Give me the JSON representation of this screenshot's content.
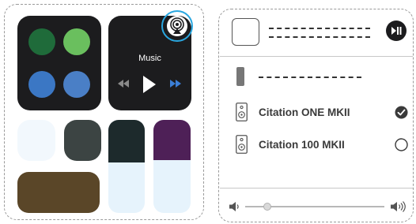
{
  "colors": {
    "tile_dark": "#1c1c1e",
    "dot_green_dark": "#1f6b3a",
    "dot_green_light": "#6abf5e",
    "dot_blue_left": "#3b77c4",
    "dot_blue_right": "#4a7fc6",
    "tile_light": "#f2f8fd",
    "tile_charcoal": "#3c4443",
    "tile_brown": "#5a4628",
    "bar_track": "#e6f3fc",
    "bar_dark": "#1d2a2c",
    "bar_purple": "#4e2057",
    "accent_ring": "#2aa7e0",
    "forward_arrows": "#3b7fd6",
    "rewind_arrows": "#8a8a8a"
  },
  "control_center": {
    "music": {
      "label": "Music",
      "airplay_icon": "airplay-audio-icon",
      "rewind_icon": "rewind-icon",
      "play_icon": "play-icon",
      "forward_icon": "fast-forward-icon"
    },
    "sliders": [
      {
        "name": "left-slider",
        "level": 0.46
      },
      {
        "name": "right-slider",
        "level": 0.43
      }
    ]
  },
  "audio_output": {
    "play_pause_icon": "play-pause-icon",
    "speakers": [
      {
        "label": "Citation ONE MKII",
        "selected": true,
        "icon": "speaker-icon"
      },
      {
        "label": "Citation 100 MKII",
        "selected": false,
        "icon": "speaker-icon"
      }
    ],
    "volume": {
      "level": 0.16,
      "low_icon": "volume-low-icon",
      "high_icon": "volume-high-icon"
    }
  }
}
